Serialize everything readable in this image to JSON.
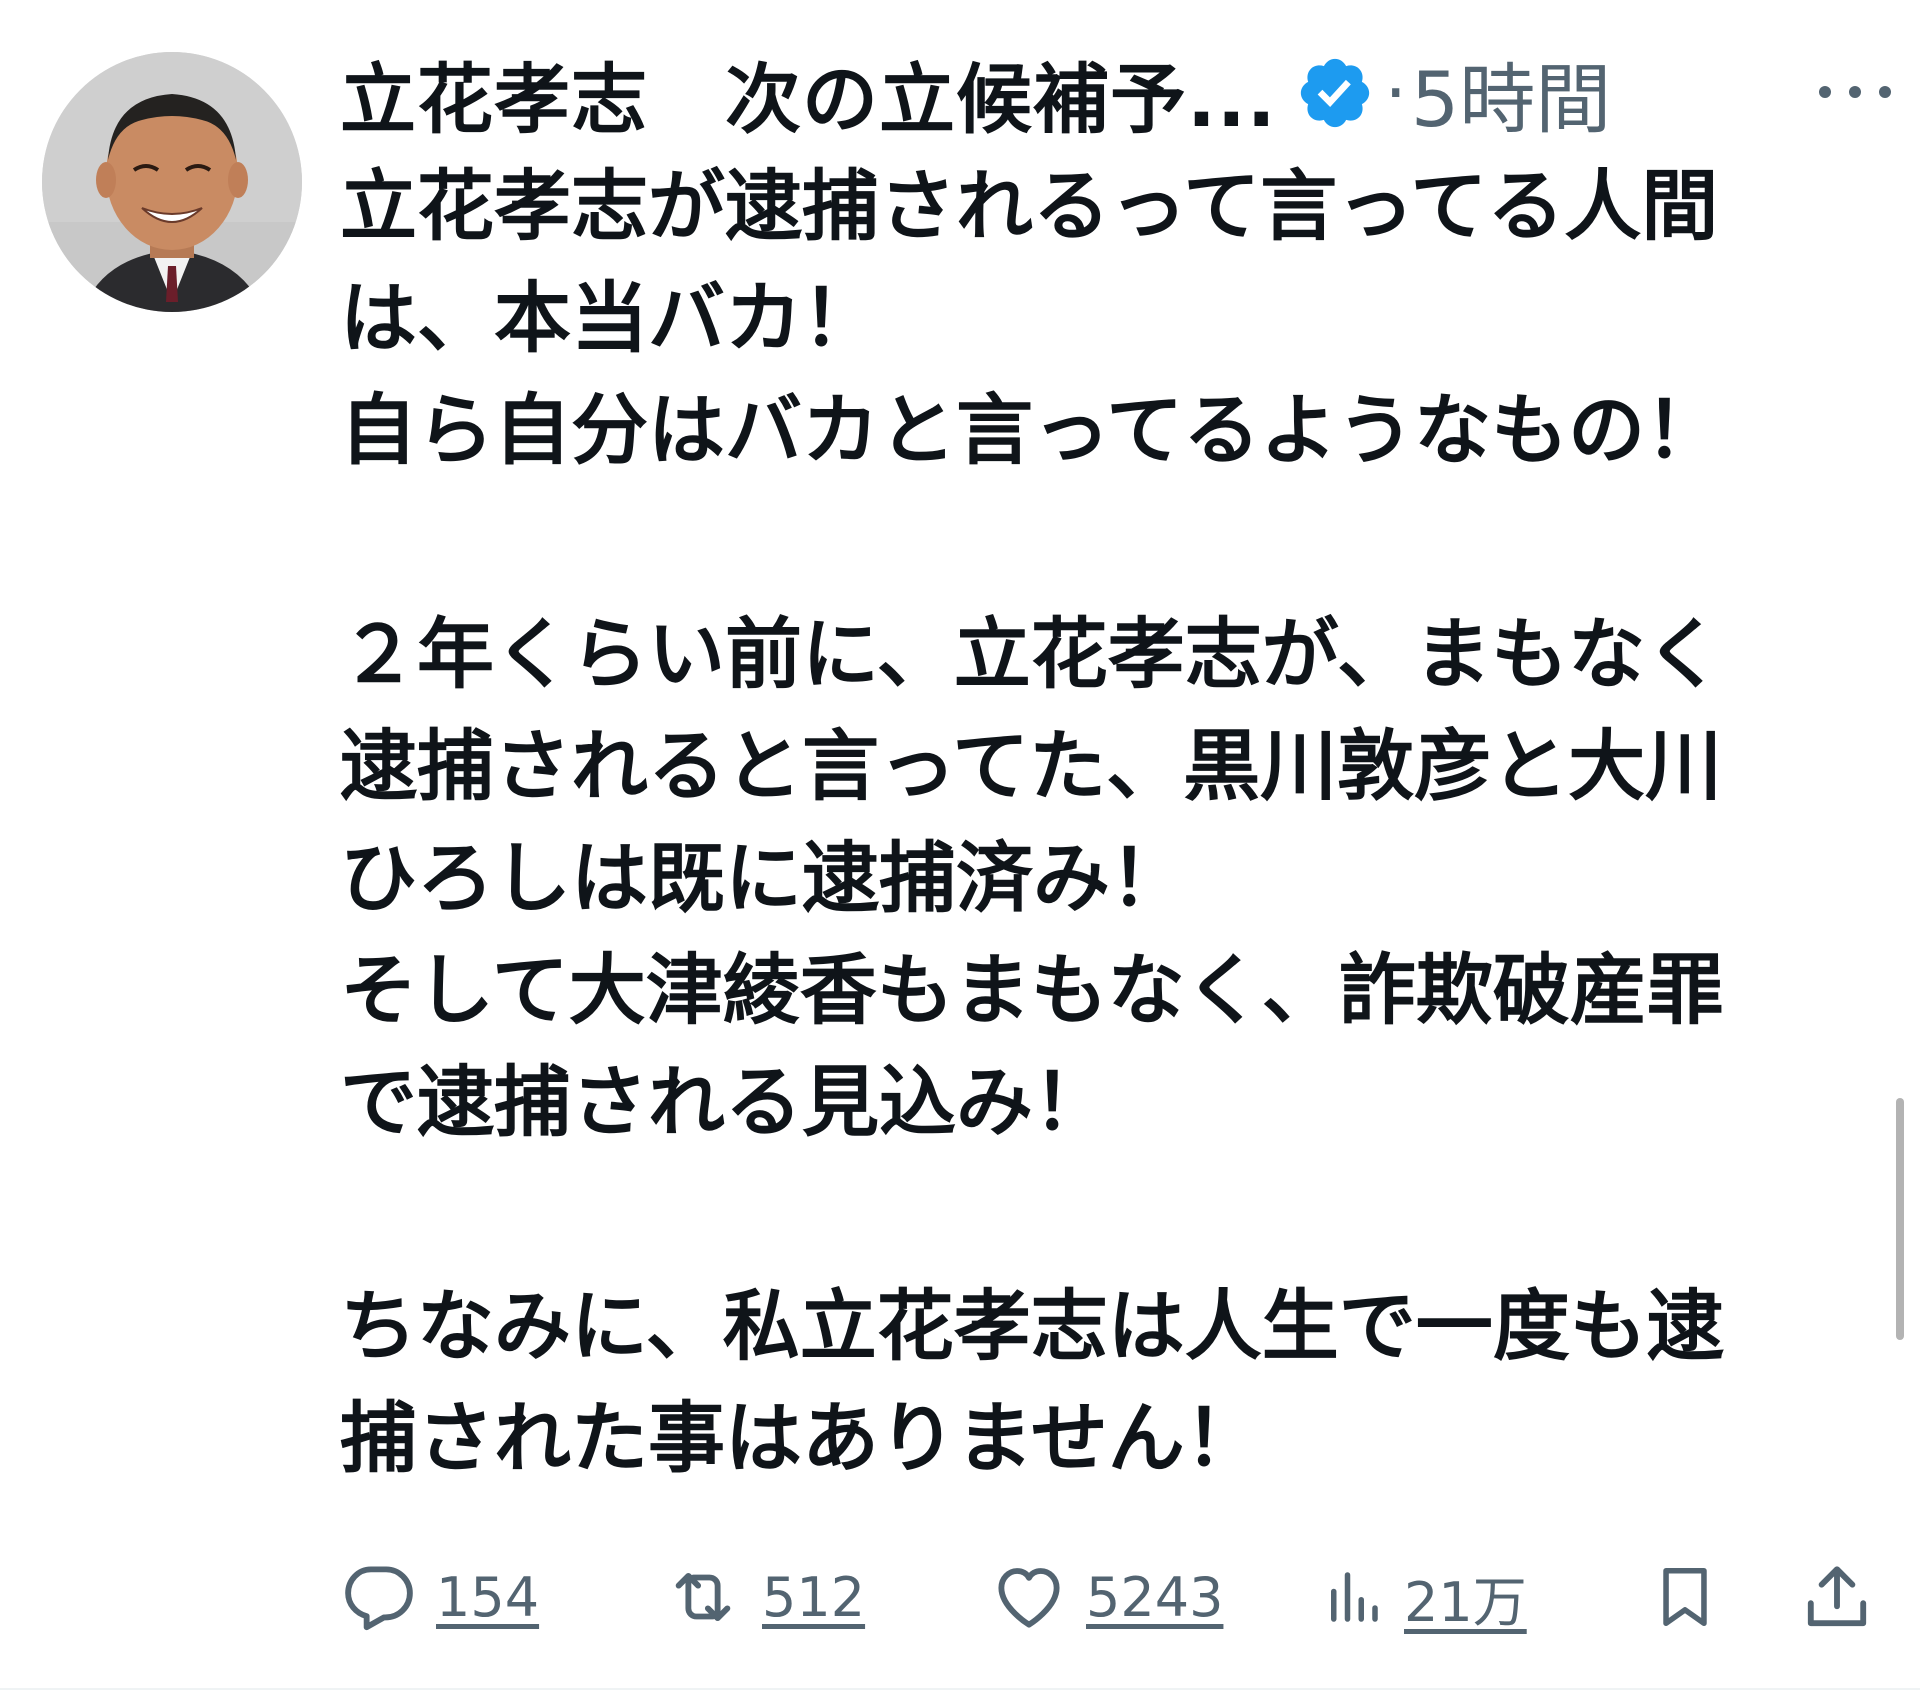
{
  "tweet": {
    "author_name": "立花孝志　次の立候補予...",
    "time": "5時間",
    "separator": "·",
    "body_lines": [
      "立花孝志が逮捕されるって言ってる人間",
      "は、本当バカ！",
      "自ら自分はバカと言ってるようなもの！",
      "",
      "２年くらい前に、立花孝志が、まもなく",
      "逮捕されると言ってた、黒川敦彦と大川",
      "ひろしは既に逮捕済み！",
      "そして大津綾香もまもなく、詐欺破産罪",
      "で逮捕される見込み！",
      "",
      "ちなみに、私立花孝志は人生で一度も逮",
      "捕された事はありません！"
    ],
    "actions": {
      "replies": "154",
      "reposts": "512",
      "likes": "5243",
      "views": "21万"
    }
  },
  "icons": {
    "verified": "verified-badge-icon",
    "more": "more-options-icon",
    "reply": "reply-icon",
    "repost": "repost-icon",
    "like": "heart-icon",
    "views": "views-chart-icon",
    "bookmark": "bookmark-icon",
    "share": "share-icon"
  },
  "colors": {
    "text": "#0f1419",
    "secondary": "#536471",
    "verified": "#1d9bf0"
  }
}
